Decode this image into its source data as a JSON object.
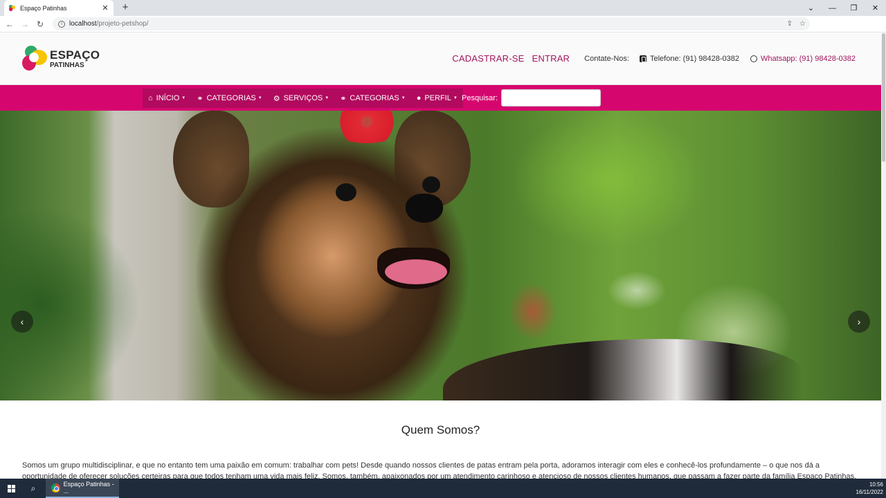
{
  "browser": {
    "tab_title": "Espaço Patinhas",
    "tab_close": "✕",
    "new_tab": "+",
    "url_host": "localhost",
    "url_path": "/projeto-petshop/",
    "window_controls": [
      "⌄",
      "—",
      "❐",
      "✕"
    ]
  },
  "header": {
    "logo_line1": "ESPAÇO",
    "logo_line2": "PATINHAS",
    "signup": "CADASTRAR-SE",
    "login": "ENTRAR",
    "contact_label": "Contate-Nos:",
    "phone": "Telefone: (91) 98428-0382",
    "whatsapp": "Whatsapp: (91) 98428-0382"
  },
  "nav": {
    "items": [
      {
        "label": "INÍCIO",
        "icon": "home-icon"
      },
      {
        "label": "CATEGORIAS",
        "icon": "bone-icon"
      },
      {
        "label": "SERVIÇOS",
        "icon": "user-cog-icon"
      },
      {
        "label": "CATEGORIAS",
        "icon": "bone-icon"
      },
      {
        "label": "PERFIL",
        "icon": "user-icon"
      }
    ],
    "search_label": "Pesquisar:",
    "search_value": ""
  },
  "carousel": {
    "prev": "‹",
    "next": "›"
  },
  "about": {
    "title": "Quem Somos?",
    "text": "Somos um grupo multidisciplinar, e que no entanto tem uma paixão em comum: trabalhar com pets! Desde quando nossos clientes de patas entram pela porta, adoramos interagir com eles e conhecê-los profundamente – o que nos dá a oportunidade de oferecer soluções certeiras para que todos tenham uma vida mais feliz. Somos, também, apaixonados por um atendimento carinhoso e atencioso de nossos clientes humanos, que passam a fazer parte da família Espaço Patinhas."
  },
  "taskbar": {
    "app_label": "Espaço Patinhas - ...",
    "time": "10:56",
    "date": "16/11/2022"
  },
  "colors": {
    "brand_pink": "#d6066f",
    "brand_dark_pink": "#a0165f"
  }
}
